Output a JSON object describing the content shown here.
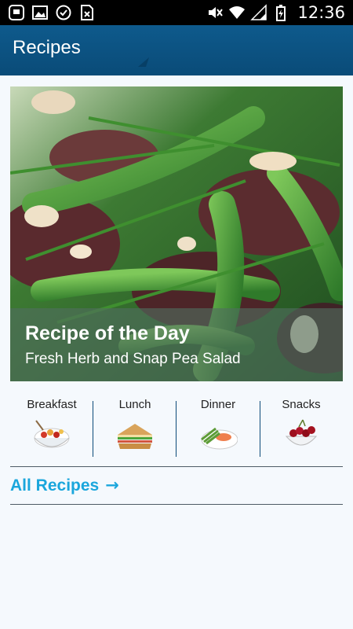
{
  "status_bar": {
    "time": "12:36",
    "icons_left": [
      "notification-icon",
      "gallery-icon",
      "check-circle-icon",
      "sim-error-icon"
    ],
    "icons_right": [
      "mute-icon",
      "wifi-icon",
      "signal-icon",
      "battery-icon"
    ]
  },
  "app_bar": {
    "title": "Recipes",
    "color": "#0b5281"
  },
  "featured": {
    "heading": "Recipe of the Day",
    "recipe_name": "Fresh Herb and Snap Pea Salad"
  },
  "categories": [
    {
      "label": "Breakfast",
      "icon": "breakfast-bowl-icon"
    },
    {
      "label": "Lunch",
      "icon": "sandwich-icon"
    },
    {
      "label": "Dinner",
      "icon": "dinner-plate-icon"
    },
    {
      "label": "Snacks",
      "icon": "cherries-bowl-icon"
    }
  ],
  "all_recipes": {
    "label": "All Recipes",
    "arrow": "→",
    "color": "#1aa6dc"
  }
}
